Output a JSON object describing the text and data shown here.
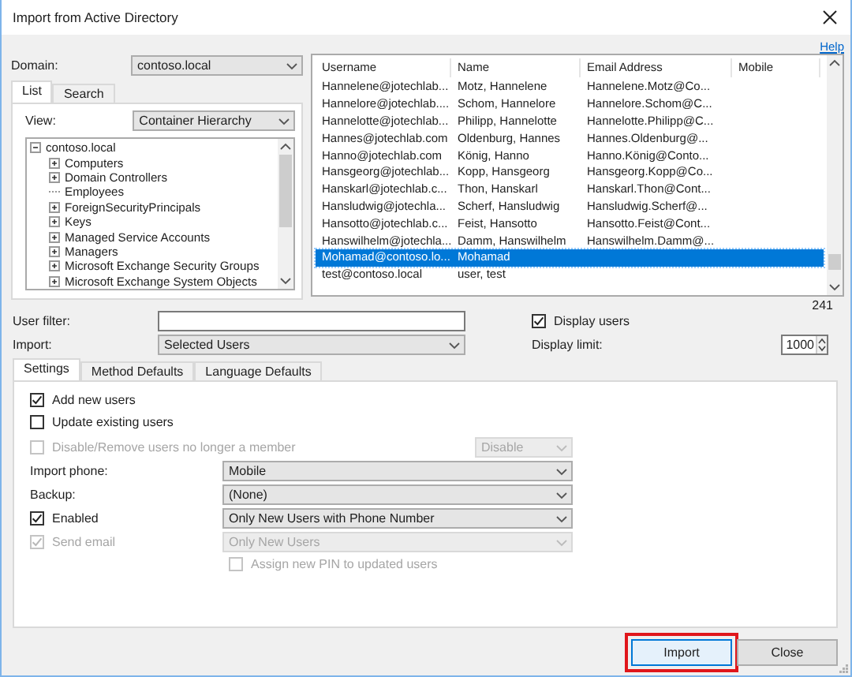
{
  "window": {
    "title": "Import from Active Directory"
  },
  "help_link": "Help",
  "domain": {
    "label": "Domain:",
    "value": "contoso.local"
  },
  "source_tabs": [
    {
      "label": "List",
      "selected": true
    },
    {
      "label": "Search",
      "selected": false
    }
  ],
  "view": {
    "label": "View:",
    "value": "Container Hierarchy"
  },
  "tree": {
    "label": "contoso.local",
    "expanded": true,
    "children": [
      {
        "label": "Computers",
        "expanded": false
      },
      {
        "label": "Domain Controllers",
        "expanded": false
      },
      {
        "label": "Employees"
      },
      {
        "label": "ForeignSecurityPrincipals",
        "expanded": false
      },
      {
        "label": "Keys",
        "expanded": false
      },
      {
        "label": "Managed Service Accounts",
        "expanded": false
      },
      {
        "label": "Managers",
        "expanded": false
      },
      {
        "label": "Microsoft Exchange Security Groups",
        "expanded": false
      },
      {
        "label": "Microsoft Exchange System Objects",
        "expanded": false
      }
    ]
  },
  "users_table": {
    "columns": [
      "Username",
      "Name",
      "Email Address",
      "Mobile"
    ],
    "rows": [
      {
        "cells": [
          "Hannelene@jotechlab...",
          "Motz, Hannelene",
          "Hannelene.Motz@Co..."
        ],
        "selected": false
      },
      {
        "cells": [
          "Hannelore@jotechlab....",
          "Schom, Hannelore",
          "Hannelore.Schom@C..."
        ],
        "selected": false
      },
      {
        "cells": [
          "Hannelotte@jotechlab...",
          "Philipp, Hannelotte",
          "Hannelotte.Philipp@C..."
        ],
        "selected": false
      },
      {
        "cells": [
          "Hannes@jotechlab.com",
          "Oldenburg, Hannes",
          "Hannes.Oldenburg@..."
        ],
        "selected": false
      },
      {
        "cells": [
          "Hanno@jotechlab.com",
          "König, Hanno",
          "Hanno.König@Conto..."
        ],
        "selected": false
      },
      {
        "cells": [
          "Hansgeorg@jotechlab...",
          "Kopp, Hansgeorg",
          "Hansgeorg.Kopp@Co..."
        ],
        "selected": false
      },
      {
        "cells": [
          "Hanskarl@jotechlab.c...",
          "Thon, Hanskarl",
          "Hanskarl.Thon@Cont..."
        ],
        "selected": false
      },
      {
        "cells": [
          "Hansludwig@jotechla...",
          "Scherf, Hansludwig",
          "Hansludwig.Scherf@..."
        ],
        "selected": false
      },
      {
        "cells": [
          "Hansotto@jotechlab.c...",
          "Feist, Hansotto",
          "Hansotto.Feist@Cont..."
        ],
        "selected": false
      },
      {
        "cells": [
          "Hanswilhelm@jotechla...",
          "Damm, Hanswilhelm",
          "Hanswilhelm.Damm@..."
        ],
        "selected": false
      },
      {
        "cells": [
          "Mohamad@contoso.lo...",
          "Mohamad"
        ],
        "selected": true
      },
      {
        "cells": [
          "test@contoso.local",
          "user, test"
        ],
        "selected": false
      }
    ]
  },
  "user_count": "241",
  "user_filter": {
    "label": "User filter:"
  },
  "display_users": {
    "label": "Display users",
    "checked": true
  },
  "import": {
    "label": "Import:",
    "value": "Selected Users"
  },
  "display_limit": {
    "label": "Display limit:",
    "value": "1000"
  },
  "settings_tabs": [
    {
      "label": "Settings",
      "selected": true
    },
    {
      "label": "Method Defaults",
      "selected": false
    },
    {
      "label": "Language Defaults",
      "selected": false
    }
  ],
  "settings": [
    {
      "kind": "checkbox",
      "label": "Add new users",
      "checked": true,
      "disabled": false
    },
    {
      "kind": "checkbox",
      "label": "Update existing users",
      "checked": false,
      "disabled": false
    },
    {
      "kind": "checkbox_option",
      "label": "Disable/Remove users no longer a member",
      "checked": false,
      "disabled": true,
      "select": {
        "value": "Disable",
        "disabled": true
      }
    },
    {
      "kind": "select",
      "label": "Import phone:",
      "select": {
        "value": "Mobile",
        "disabled": false
      }
    },
    {
      "kind": "select",
      "label": "Backup:",
      "select": {
        "value": "(None)",
        "disabled": false
      }
    },
    {
      "kind": "checkbox_select",
      "label": "Enabled",
      "checked": true,
      "disabled": false,
      "select": {
        "value": "Only New Users with Phone Number",
        "disabled": false
      }
    },
    {
      "kind": "checkbox_select",
      "label": "Send email",
      "checked": true,
      "disabled": true,
      "select": {
        "value": "Only New Users",
        "disabled": true
      }
    },
    {
      "kind": "sub_checkbox",
      "label": "Assign new PIN to updated users",
      "checked": false,
      "disabled": true
    }
  ],
  "buttons": [
    {
      "label": "Import",
      "highlighted": true
    },
    {
      "label": "Close",
      "highlighted": false
    }
  ]
}
